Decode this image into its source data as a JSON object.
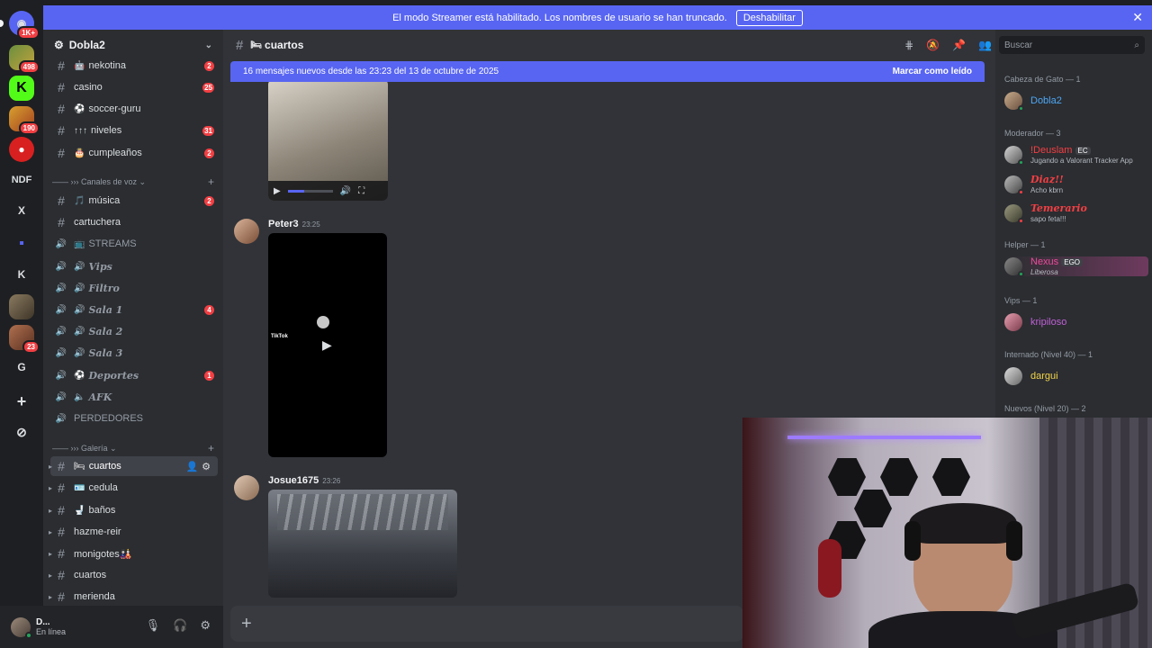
{
  "banner": {
    "text": "El modo Streamer está habilitado. Los nombres de usuario se han truncado.",
    "button": "Deshabilitar",
    "close": "✕"
  },
  "rail": {
    "items": [
      {
        "name": "discord-home-icon",
        "glyph": "◉",
        "badge": "1K+"
      },
      {
        "name": "server-1-icon",
        "glyph": "",
        "badge": "498"
      },
      {
        "name": "kick-icon",
        "glyph": "K",
        "badge": ""
      },
      {
        "name": "server-3-icon",
        "glyph": "",
        "badge": "190"
      },
      {
        "name": "spider-icon",
        "glyph": "●",
        "badge": ""
      },
      {
        "name": "server-ndf",
        "glyph": "NDF",
        "badge": ""
      },
      {
        "name": "server-x",
        "glyph": "X",
        "badge": ""
      },
      {
        "name": "folder-icon",
        "glyph": "▪",
        "badge": ""
      },
      {
        "name": "server-k",
        "glyph": "K",
        "badge": ""
      },
      {
        "name": "server-8-icon",
        "glyph": "",
        "badge": ""
      },
      {
        "name": "server-9-icon",
        "glyph": "",
        "badge": "23"
      },
      {
        "name": "server-g",
        "glyph": "G",
        "badge": ""
      },
      {
        "name": "add-server-icon",
        "glyph": "+",
        "badge": ""
      },
      {
        "name": "explore-icon",
        "glyph": "⊘",
        "badge": ""
      }
    ]
  },
  "guild": {
    "name": "Dobla2",
    "caret": "⌄"
  },
  "channels": {
    "text_top": [
      {
        "emoji": "🤖",
        "name": "nekotina",
        "count": "2"
      },
      {
        "emoji": "",
        "name": "casino",
        "count": "25"
      },
      {
        "emoji": "⚽",
        "name": "soccer-guru",
        "count": ""
      },
      {
        "emoji": "↑↑↑",
        "name": "niveles",
        "count": "31"
      },
      {
        "emoji": "🎂",
        "name": "cumpleaños",
        "count": "2"
      }
    ],
    "voice_category": "Canales de voz",
    "voice": [
      {
        "icon": "#",
        "emoji": "🎵",
        "name": "música",
        "count": "2",
        "style": "normal"
      },
      {
        "icon": "#",
        "emoji": "",
        "name": "cartuchera",
        "count": "",
        "style": "normal"
      },
      {
        "icon": "🔊",
        "emoji": "📺",
        "name": "STREAMS",
        "count": "",
        "style": "dim"
      },
      {
        "icon": "🔊",
        "emoji": "🔊",
        "name": "Vips",
        "count": "",
        "style": "italic"
      },
      {
        "icon": "🔊",
        "emoji": "🔊",
        "name": "Filtro",
        "count": "",
        "style": "italic"
      },
      {
        "icon": "🔊",
        "emoji": "🔊",
        "name": "Sala 1",
        "count": "4",
        "style": "italic"
      },
      {
        "icon": "🔊",
        "emoji": "🔊",
        "name": "Sala 2",
        "count": "",
        "style": "italic"
      },
      {
        "icon": "🔊",
        "emoji": "🔊",
        "name": "Sala 3",
        "count": "",
        "style": "italic"
      },
      {
        "icon": "🔊",
        "emoji": "⚽",
        "name": "Deportes",
        "count": "1",
        "style": "italic"
      },
      {
        "icon": "🔊",
        "emoji": "🔈",
        "name": "AFK",
        "count": "",
        "style": "italic"
      },
      {
        "icon": "🔊",
        "emoji": "",
        "name": "PERDEDORES",
        "count": "",
        "style": "dim"
      }
    ],
    "gallery_category": "Galería",
    "gallery": [
      {
        "emoji": "🛏",
        "name": "cuartos",
        "active": true
      },
      {
        "emoji": "🪪",
        "name": "cedula",
        "active": false
      },
      {
        "emoji": "🚽",
        "name": "baños",
        "active": false
      },
      {
        "emoji": "",
        "name": "hazme-reir",
        "active": false
      },
      {
        "emoji": "",
        "name": "monigotes🎎",
        "active": false
      },
      {
        "emoji": "",
        "name": "cuartos",
        "active": false
      },
      {
        "emoji": "",
        "name": "merienda",
        "active": false
      }
    ]
  },
  "user": {
    "name": "D...",
    "status": "En línea"
  },
  "chat": {
    "channel": "cuartos",
    "channel_emoji": "🛏",
    "new_messages": "16 mensajes nuevos desde las 23:23 del 13 de octubre de 2025",
    "mark_read": "Marcar como leído",
    "messages": [
      {
        "author": "Peter3",
        "time": "23:25"
      },
      {
        "author": "Josue1675",
        "time": "23:26"
      }
    ],
    "tiktok_label": "TikTok"
  },
  "members": {
    "search_placeholder": "Buscar",
    "groups": [
      {
        "role": "Cabeza de Gato — 1",
        "members": [
          {
            "name": "Dobla2",
            "status": "",
            "color": "#4ea7f4"
          }
        ]
      },
      {
        "role": "Moderador — 3",
        "members": [
          {
            "name": "!Deuslam",
            "status": "Jugando a Valorant Tracker App",
            "color": "#f23f43",
            "tag": "EC"
          },
          {
            "name": "Diaz!!",
            "status": "Acho kbrn",
            "color": "#f23f43"
          },
          {
            "name": "Temerario",
            "status": "sapo feta!!!",
            "color": "#f23f43"
          }
        ]
      },
      {
        "role": "Helper — 1",
        "members": [
          {
            "name": "Nexus",
            "status": "Liberosa",
            "color": "#ed4a9b",
            "tag": "EGO"
          }
        ]
      },
      {
        "role": "Vips — 1",
        "members": [
          {
            "name": "kripiloso",
            "status": "",
            "color": "#c060d6"
          }
        ]
      },
      {
        "role": "Internado (Nivel 40) — 1",
        "members": [
          {
            "name": "dargui",
            "status": "",
            "color": "#f0d34a"
          }
        ]
      },
      {
        "role": "Nuevos (Nivel 20) — 2",
        "members": []
      }
    ]
  }
}
